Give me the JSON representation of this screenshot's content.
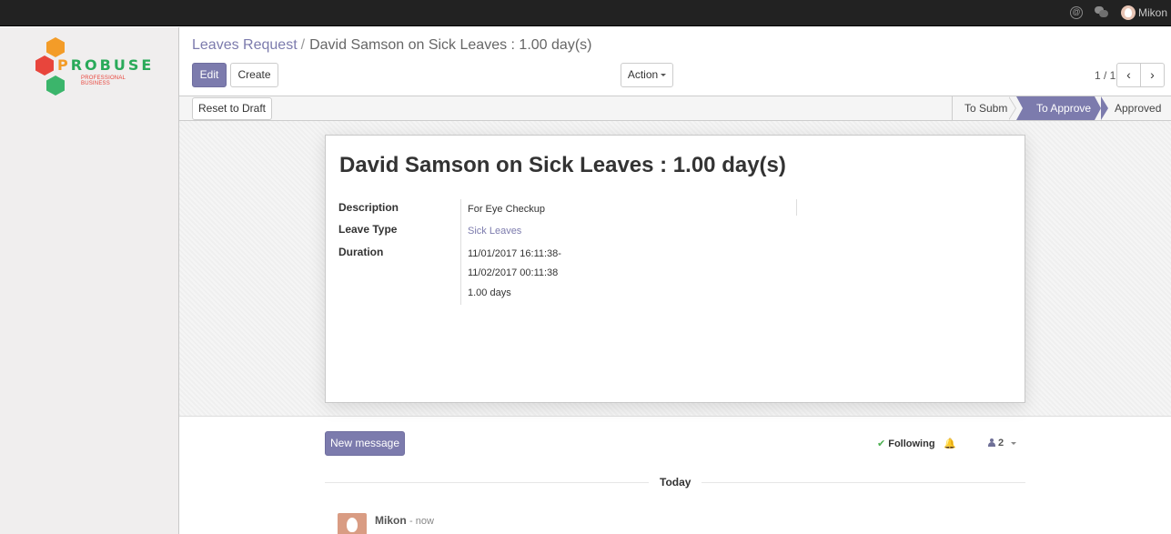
{
  "topbar": {
    "user_name": "Mikon"
  },
  "logo": {
    "brand_first": "P",
    "brand_rest": "ROBUSE",
    "tagline": "PROFESSIONAL BUSINESS"
  },
  "breadcrumb": {
    "parent": "Leaves Request",
    "separator": "/",
    "current": "David Samson on Sick Leaves : 1.00 day(s)"
  },
  "buttons": {
    "edit": "Edit",
    "create": "Create",
    "action": "Action",
    "reset_to_draft": "Reset to Draft",
    "new_message": "New message"
  },
  "pager": {
    "value": "1 / 1",
    "prev_icon": "‹",
    "next_icon": "›"
  },
  "statusbar": {
    "stages": [
      "To Submit",
      "To Approve",
      "Approved"
    ],
    "active": "To Approve"
  },
  "record": {
    "title": "David Samson on Sick Leaves : 1.00 day(s)",
    "fields": {
      "description_label": "Description",
      "description_value": "For Eye Checkup",
      "leave_type_label": "Leave Type",
      "leave_type_value": "Sick Leaves",
      "duration_label": "Duration",
      "duration_from": "11/01/2017 16:11:38-",
      "duration_to": "11/02/2017 00:11:38",
      "duration_days": "1.00 days"
    }
  },
  "chatter": {
    "following_label": "Following",
    "followers_count": "2",
    "day_separator": "Today",
    "messages": [
      {
        "author": "Mikon",
        "time": "- now"
      }
    ]
  },
  "colors": {
    "primary": "#7c7bad",
    "topbar": "#222222",
    "sidebar": "#f0eeee"
  }
}
